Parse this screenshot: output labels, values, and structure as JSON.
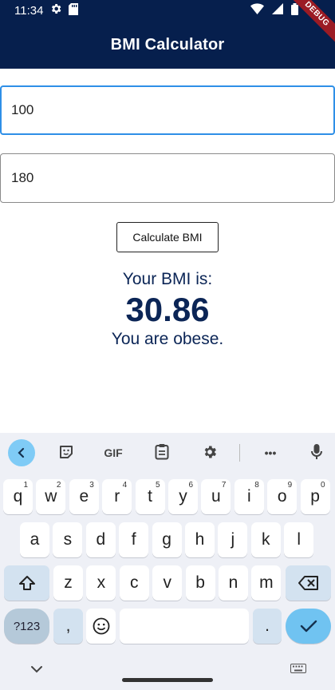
{
  "status": {
    "time": "11:34"
  },
  "app": {
    "title": "BMI Calculator",
    "debug_label": "DEBUG"
  },
  "form": {
    "weight_value": "100",
    "height_value": "180",
    "calculate_label": "Calculate BMI"
  },
  "result": {
    "heading": "Your BMI is:",
    "value": "30.86",
    "category": "You are obese."
  },
  "keyboard": {
    "toolbar": {
      "gif_label": "GIF",
      "more_label": "•••"
    },
    "row1": [
      {
        "k": "q",
        "s": "1"
      },
      {
        "k": "w",
        "s": "2"
      },
      {
        "k": "e",
        "s": "3"
      },
      {
        "k": "r",
        "s": "4"
      },
      {
        "k": "t",
        "s": "5"
      },
      {
        "k": "y",
        "s": "6"
      },
      {
        "k": "u",
        "s": "7"
      },
      {
        "k": "i",
        "s": "8"
      },
      {
        "k": "o",
        "s": "9"
      },
      {
        "k": "p",
        "s": "0"
      }
    ],
    "row2": [
      "a",
      "s",
      "d",
      "f",
      "g",
      "h",
      "j",
      "k",
      "l"
    ],
    "row3": [
      "z",
      "x",
      "c",
      "v",
      "b",
      "n",
      "m"
    ],
    "sym_label": "?123",
    "comma_label": ",",
    "period_label": "."
  },
  "colors": {
    "appbar": "#061f4d",
    "focus_border": "#2e8fe7",
    "result_text": "#0b2556",
    "enter_key": "#70c3f1"
  }
}
